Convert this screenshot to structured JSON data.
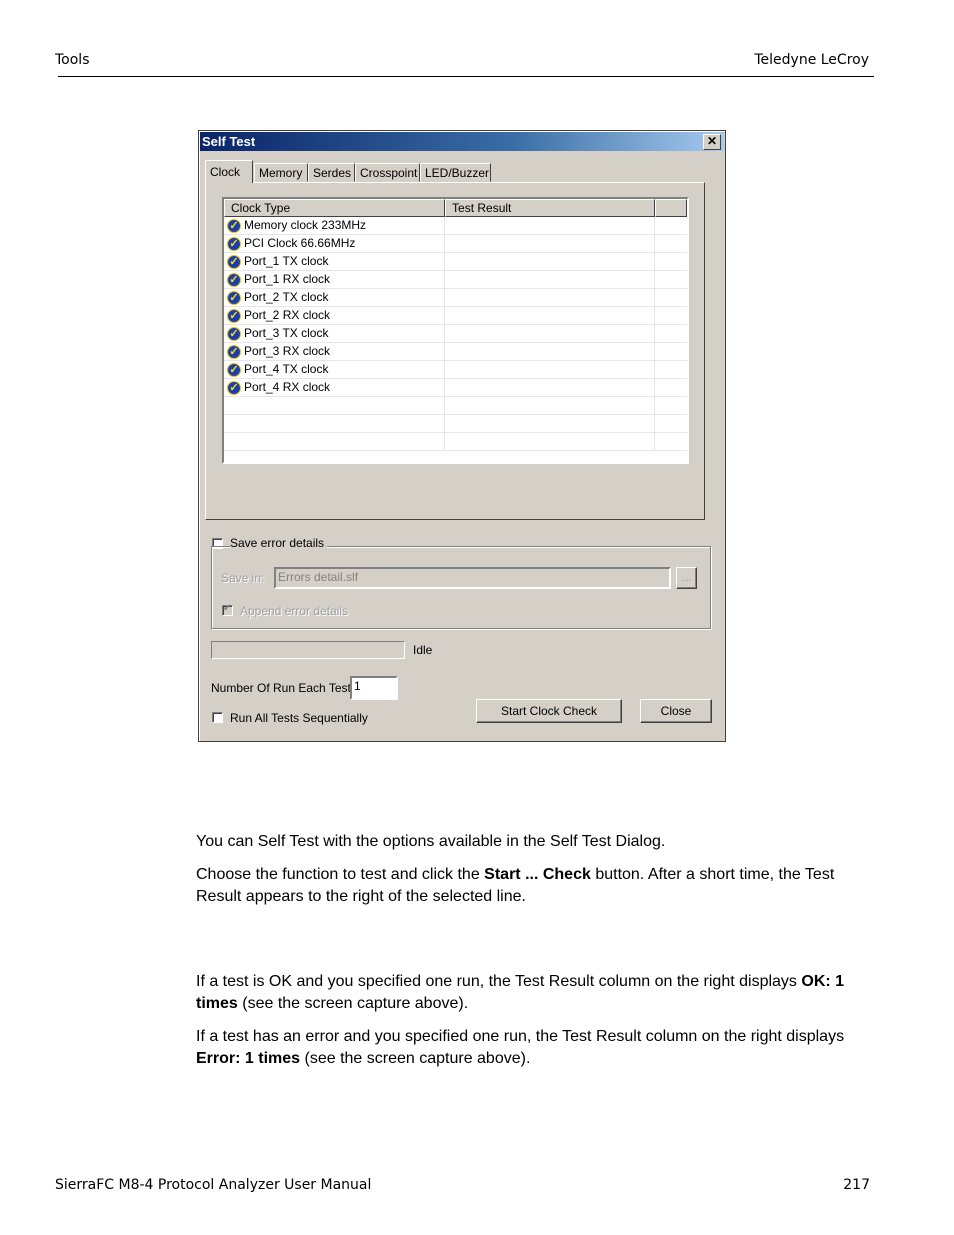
{
  "header": {
    "left": "Tools",
    "right": "Teledyne LeCroy"
  },
  "dialog": {
    "title": "Self Test",
    "close_glyph": "✕",
    "tabs": [
      {
        "label": "Clock",
        "active": true
      },
      {
        "label": "Memory"
      },
      {
        "label": "Serdes"
      },
      {
        "label": "Crosspoint"
      },
      {
        "label": "LED/Buzzer"
      }
    ],
    "columns": [
      "Clock Type",
      "Test Result"
    ],
    "rows": [
      {
        "type": "Memory clock 233MHz",
        "result": "",
        "icon": "check-shield-icon"
      },
      {
        "type": "PCI Clock 66.66MHz",
        "result": "",
        "icon": "check-shield-icon"
      },
      {
        "type": "Port_1 TX clock",
        "result": "",
        "icon": "check-shield-icon"
      },
      {
        "type": "Port_1 RX clock",
        "result": "",
        "icon": "check-shield-icon"
      },
      {
        "type": "Port_2 TX clock",
        "result": "",
        "icon": "check-shield-icon"
      },
      {
        "type": "Port_2 RX clock",
        "result": "",
        "icon": "check-shield-icon"
      },
      {
        "type": "Port_3 TX clock",
        "result": "",
        "icon": "check-shield-icon"
      },
      {
        "type": "Port_3 RX clock",
        "result": "",
        "icon": "check-shield-icon"
      },
      {
        "type": "Port_4 TX clock",
        "result": "",
        "icon": "check-shield-icon"
      },
      {
        "type": "Port_4 RX clock",
        "result": "",
        "icon": "check-shield-icon"
      }
    ],
    "empty_rows": 3,
    "save_error_details": {
      "label": "Save error details",
      "checked": false
    },
    "save_in": {
      "label": "Save in:",
      "value": "Errors detail.slf",
      "browse_label": "..."
    },
    "append_error_details": {
      "label": "Append error details",
      "checked": true
    },
    "status": "Idle",
    "progress": 0,
    "number_of_run": {
      "label": "Number Of Run Each Test:",
      "value": "1"
    },
    "run_all": {
      "label": "Run All Tests Sequentially",
      "checked": false
    },
    "start_button": "Start Clock Check",
    "close_button": "Close"
  },
  "body": {
    "p1": "You can Self Test with the options available in the Self Test Dialog.",
    "p2_a": "Choose the function to test and click the ",
    "p2_b": "Start ... Check",
    "p2_c": " button. After a short time, the Test Result appears to the right of the selected line.",
    "p3_a": "If a test is OK and you specified one run, the Test Result column on the right displays ",
    "p3_b": "OK: 1 times",
    "p3_c": " (see the screen capture above).",
    "p4_a": "If a test has an error and you specified one run, the Test Result column on the right displays ",
    "p4_b": "Error: 1 times",
    "p4_c": " (see the screen capture above)."
  },
  "footer": {
    "left": "SierraFC M8-4 Protocol Analyzer User Manual",
    "right": "217"
  }
}
